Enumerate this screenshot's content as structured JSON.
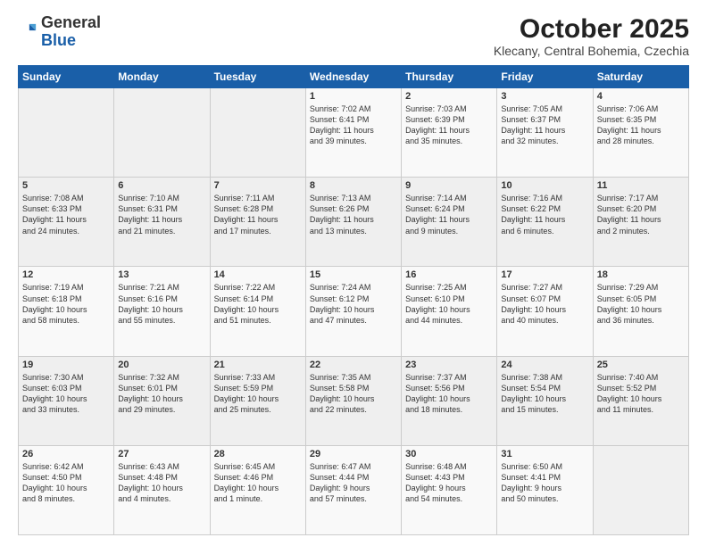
{
  "header": {
    "logo_general": "General",
    "logo_blue": "Blue",
    "month_title": "October 2025",
    "location": "Klecany, Central Bohemia, Czechia"
  },
  "days_of_week": [
    "Sunday",
    "Monday",
    "Tuesday",
    "Wednesday",
    "Thursday",
    "Friday",
    "Saturday"
  ],
  "weeks": [
    [
      {
        "day": "",
        "info": ""
      },
      {
        "day": "",
        "info": ""
      },
      {
        "day": "",
        "info": ""
      },
      {
        "day": "1",
        "info": "Sunrise: 7:02 AM\nSunset: 6:41 PM\nDaylight: 11 hours\nand 39 minutes."
      },
      {
        "day": "2",
        "info": "Sunrise: 7:03 AM\nSunset: 6:39 PM\nDaylight: 11 hours\nand 35 minutes."
      },
      {
        "day": "3",
        "info": "Sunrise: 7:05 AM\nSunset: 6:37 PM\nDaylight: 11 hours\nand 32 minutes."
      },
      {
        "day": "4",
        "info": "Sunrise: 7:06 AM\nSunset: 6:35 PM\nDaylight: 11 hours\nand 28 minutes."
      }
    ],
    [
      {
        "day": "5",
        "info": "Sunrise: 7:08 AM\nSunset: 6:33 PM\nDaylight: 11 hours\nand 24 minutes."
      },
      {
        "day": "6",
        "info": "Sunrise: 7:10 AM\nSunset: 6:31 PM\nDaylight: 11 hours\nand 21 minutes."
      },
      {
        "day": "7",
        "info": "Sunrise: 7:11 AM\nSunset: 6:28 PM\nDaylight: 11 hours\nand 17 minutes."
      },
      {
        "day": "8",
        "info": "Sunrise: 7:13 AM\nSunset: 6:26 PM\nDaylight: 11 hours\nand 13 minutes."
      },
      {
        "day": "9",
        "info": "Sunrise: 7:14 AM\nSunset: 6:24 PM\nDaylight: 11 hours\nand 9 minutes."
      },
      {
        "day": "10",
        "info": "Sunrise: 7:16 AM\nSunset: 6:22 PM\nDaylight: 11 hours\nand 6 minutes."
      },
      {
        "day": "11",
        "info": "Sunrise: 7:17 AM\nSunset: 6:20 PM\nDaylight: 11 hours\nand 2 minutes."
      }
    ],
    [
      {
        "day": "12",
        "info": "Sunrise: 7:19 AM\nSunset: 6:18 PM\nDaylight: 10 hours\nand 58 minutes."
      },
      {
        "day": "13",
        "info": "Sunrise: 7:21 AM\nSunset: 6:16 PM\nDaylight: 10 hours\nand 55 minutes."
      },
      {
        "day": "14",
        "info": "Sunrise: 7:22 AM\nSunset: 6:14 PM\nDaylight: 10 hours\nand 51 minutes."
      },
      {
        "day": "15",
        "info": "Sunrise: 7:24 AM\nSunset: 6:12 PM\nDaylight: 10 hours\nand 47 minutes."
      },
      {
        "day": "16",
        "info": "Sunrise: 7:25 AM\nSunset: 6:10 PM\nDaylight: 10 hours\nand 44 minutes."
      },
      {
        "day": "17",
        "info": "Sunrise: 7:27 AM\nSunset: 6:07 PM\nDaylight: 10 hours\nand 40 minutes."
      },
      {
        "day": "18",
        "info": "Sunrise: 7:29 AM\nSunset: 6:05 PM\nDaylight: 10 hours\nand 36 minutes."
      }
    ],
    [
      {
        "day": "19",
        "info": "Sunrise: 7:30 AM\nSunset: 6:03 PM\nDaylight: 10 hours\nand 33 minutes."
      },
      {
        "day": "20",
        "info": "Sunrise: 7:32 AM\nSunset: 6:01 PM\nDaylight: 10 hours\nand 29 minutes."
      },
      {
        "day": "21",
        "info": "Sunrise: 7:33 AM\nSunset: 5:59 PM\nDaylight: 10 hours\nand 25 minutes."
      },
      {
        "day": "22",
        "info": "Sunrise: 7:35 AM\nSunset: 5:58 PM\nDaylight: 10 hours\nand 22 minutes."
      },
      {
        "day": "23",
        "info": "Sunrise: 7:37 AM\nSunset: 5:56 PM\nDaylight: 10 hours\nand 18 minutes."
      },
      {
        "day": "24",
        "info": "Sunrise: 7:38 AM\nSunset: 5:54 PM\nDaylight: 10 hours\nand 15 minutes."
      },
      {
        "day": "25",
        "info": "Sunrise: 7:40 AM\nSunset: 5:52 PM\nDaylight: 10 hours\nand 11 minutes."
      }
    ],
    [
      {
        "day": "26",
        "info": "Sunrise: 6:42 AM\nSunset: 4:50 PM\nDaylight: 10 hours\nand 8 minutes."
      },
      {
        "day": "27",
        "info": "Sunrise: 6:43 AM\nSunset: 4:48 PM\nDaylight: 10 hours\nand 4 minutes."
      },
      {
        "day": "28",
        "info": "Sunrise: 6:45 AM\nSunset: 4:46 PM\nDaylight: 10 hours\nand 1 minute."
      },
      {
        "day": "29",
        "info": "Sunrise: 6:47 AM\nSunset: 4:44 PM\nDaylight: 9 hours\nand 57 minutes."
      },
      {
        "day": "30",
        "info": "Sunrise: 6:48 AM\nSunset: 4:43 PM\nDaylight: 9 hours\nand 54 minutes."
      },
      {
        "day": "31",
        "info": "Sunrise: 6:50 AM\nSunset: 4:41 PM\nDaylight: 9 hours\nand 50 minutes."
      },
      {
        "day": "",
        "info": ""
      }
    ]
  ]
}
